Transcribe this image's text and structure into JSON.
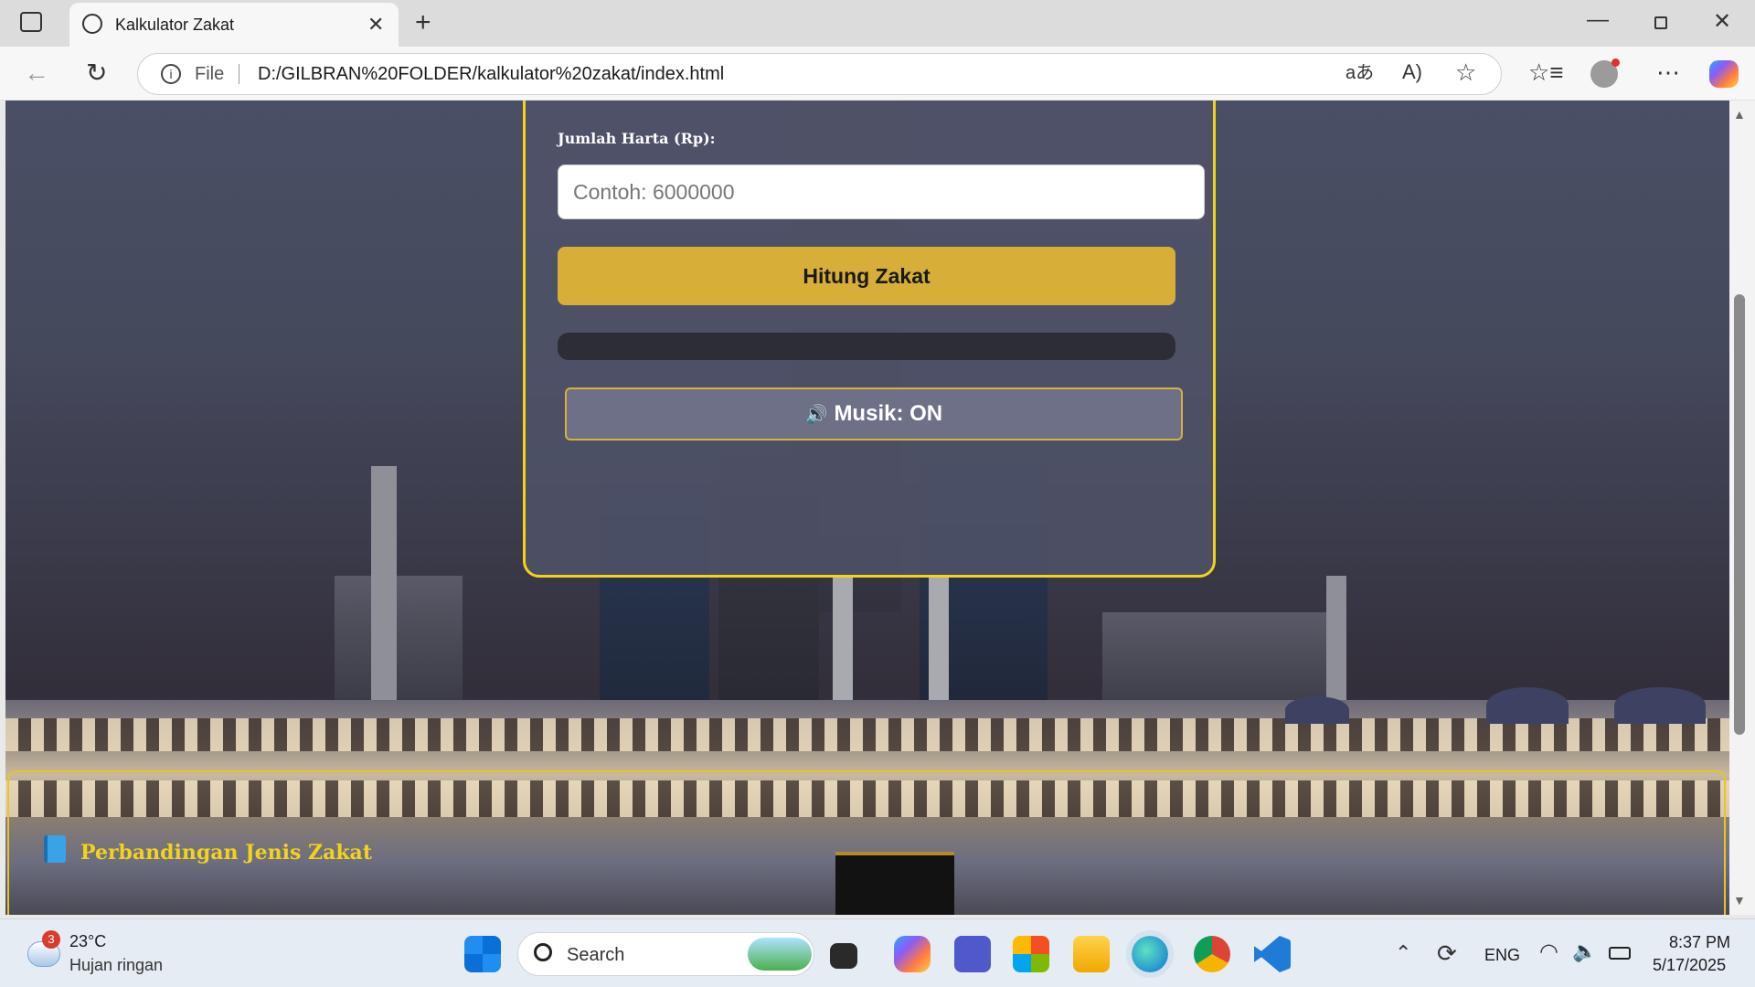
{
  "browser": {
    "tab_title": "Kalkulator Zakat",
    "url_scheme_label": "File",
    "url": "D:/GILBRAN%20FOLDER/kalkulator%20zakat/index.html"
  },
  "form": {
    "amount_label": "Jumlah Harta (Rp):",
    "amount_placeholder": "Contoh: 6000000",
    "calculate_button": "Hitung Zakat",
    "music_button": "Musik: ON",
    "music_icon": "🔊"
  },
  "section": {
    "title": "Perbandingan Jenis Zakat",
    "icon": "book-icon"
  },
  "taskbar": {
    "weather_badge": "3",
    "weather_temp": "23°C",
    "weather_desc": "Hujan ringan",
    "search_label": "Search",
    "language": "ENG",
    "time": "8:37 PM",
    "date": "5/17/2025"
  },
  "colors": {
    "accent_gold": "#d6ae38",
    "card_border": "#f2d21a",
    "section_title": "#f2d21a"
  }
}
